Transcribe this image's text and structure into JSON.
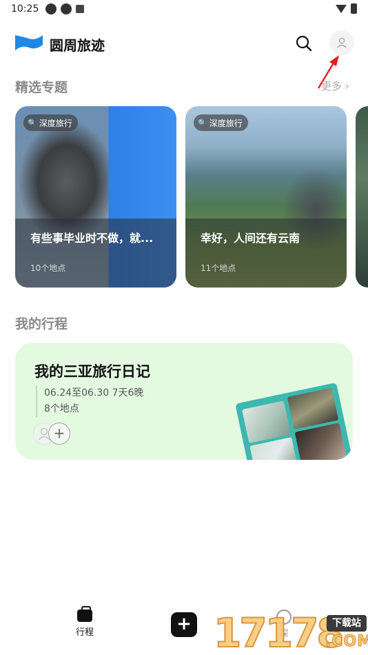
{
  "status_bar": {
    "time": "10:25",
    "left_icons": [
      "sync-icon",
      "sync-icon",
      "notification-icon"
    ],
    "right_icons": [
      "wifi-icon",
      "battery-icon"
    ]
  },
  "header": {
    "app_title": "圆周旅迹",
    "logo_icon": "flag-logo",
    "search_icon": "search-icon",
    "user_icon": "user-icon"
  },
  "featured": {
    "title": "精选专题",
    "more_label": "更多",
    "cards": [
      {
        "tag": "深度旅行",
        "title": "有些事毕业时不做，就...",
        "count": "10个地点"
      },
      {
        "tag": "深度旅行",
        "title": "幸好，人间还有云南",
        "count": "11个地点"
      }
    ]
  },
  "my_trips": {
    "title": "我的行程",
    "trip": {
      "title": "我的三亚旅行日记",
      "dates": "06.24至06.30 7天6晚",
      "places": "8个地点",
      "add_symbol": "+"
    }
  },
  "bottom_nav": {
    "trips_label": "行程",
    "add_symbol": "+",
    "explore_label": "探"
  },
  "watermark": {
    "number": "17178",
    "site": "下载站",
    "domain": ".COM"
  },
  "colors": {
    "trip_card_bg": "#e3fae0",
    "accent_blue": "#1e88e5",
    "arrow_red": "#e02020"
  }
}
